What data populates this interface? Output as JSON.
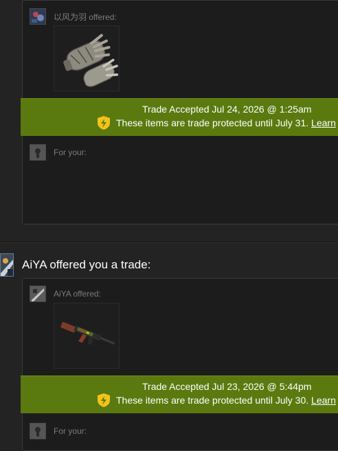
{
  "trades": [
    {
      "offer_label": "以风为羽 offered:",
      "item_name": "Gloves",
      "banner_title": "Trade Accepted Jul 24, 2026 @ 1:25am",
      "protected_text": "These items are trade protected until July 31.",
      "learn_link": "Learn",
      "for_your_label": "For your:"
    },
    {
      "header_text": "AiYA offered you a trade:",
      "offer_label": "AiYA offered:",
      "item_name": "AK-47",
      "banner_title": "Trade Accepted Jul 23, 2026 @ 5:44pm",
      "protected_text": "These items are trade protected until July 30.",
      "learn_link": "Learn",
      "for_your_label": "For your:"
    }
  ],
  "colors": {
    "banner_green": "#5a7a10",
    "shield_yellow": "#f2c21b",
    "panel_bg": "#1c1c1c",
    "page_bg": "#232323"
  },
  "icons": {
    "shield": "trade-protected-shield-icon",
    "gloves": "gloves-item-icon",
    "rifle": "rifle-item-icon"
  }
}
